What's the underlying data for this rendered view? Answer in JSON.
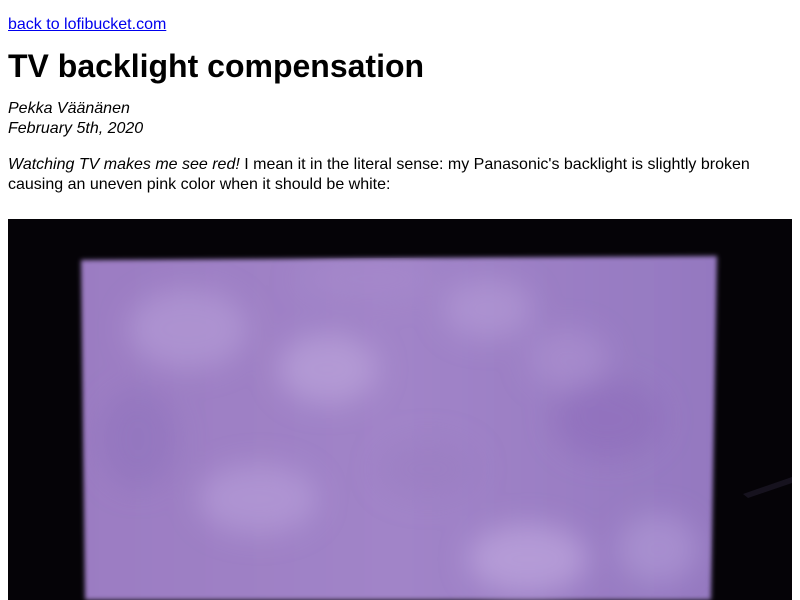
{
  "nav": {
    "back_link": "back to lofibucket.com"
  },
  "article": {
    "title": "TV backlight compensation",
    "author": "Pekka Väänänen",
    "date": "February 5th, 2020",
    "intro_emphasis": "Watching TV makes me see red!",
    "intro_text": " I mean it in the literal sense: my Panasonic's backlight is slightly broken causing an uneven pink color when it should be white:"
  },
  "colors": {
    "link": "#0000ee",
    "screen_base": "#9a7fc0",
    "bezel": "#050307"
  }
}
